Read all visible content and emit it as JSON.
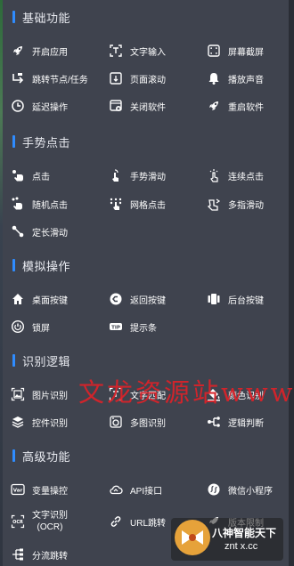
{
  "sections": [
    {
      "title": "基础功能",
      "items": [
        "开启应用",
        "文字输入",
        "屏幕截屏",
        "跳转节点/任务",
        "页面滚动",
        "播放声音",
        "延迟操作",
        "关闭软件",
        "重启软件"
      ]
    },
    {
      "title": "手势点击",
      "items": [
        "点击",
        "手势滑动",
        "连续点击",
        "随机点击",
        "网格点击",
        "多指滑动",
        "定长滑动"
      ]
    },
    {
      "title": "模拟操作",
      "items": [
        "桌面按键",
        "返回按键",
        "后台按键",
        "锁屏",
        "提示条"
      ]
    },
    {
      "title": "识别逻辑",
      "items": [
        "图片识别",
        "文字匹配",
        "颜色识别",
        "控件识别",
        "多图识别",
        "逻辑判断"
      ]
    },
    {
      "title": "高级功能",
      "items": [
        "变量操控",
        "API接口",
        "微信小程序",
        "文字识别",
        "(OCR)",
        "URL跳转",
        "版本限制",
        "分流跳转"
      ]
    }
  ],
  "icons": {
    "rocket": "rocket-icon",
    "text-scan": "text-input-icon",
    "screenshot": "screenshot-icon",
    "jump": "jump-icon",
    "scroll": "page-scroll-icon",
    "bell": "bell-icon",
    "clock": "clock-icon",
    "close-app": "close-app-icon"
  },
  "watermark": "文龙资源站www",
  "logo": {
    "line1": "八神智能天下",
    "line2": "znt x.cc"
  },
  "accent": "#2f8cff"
}
